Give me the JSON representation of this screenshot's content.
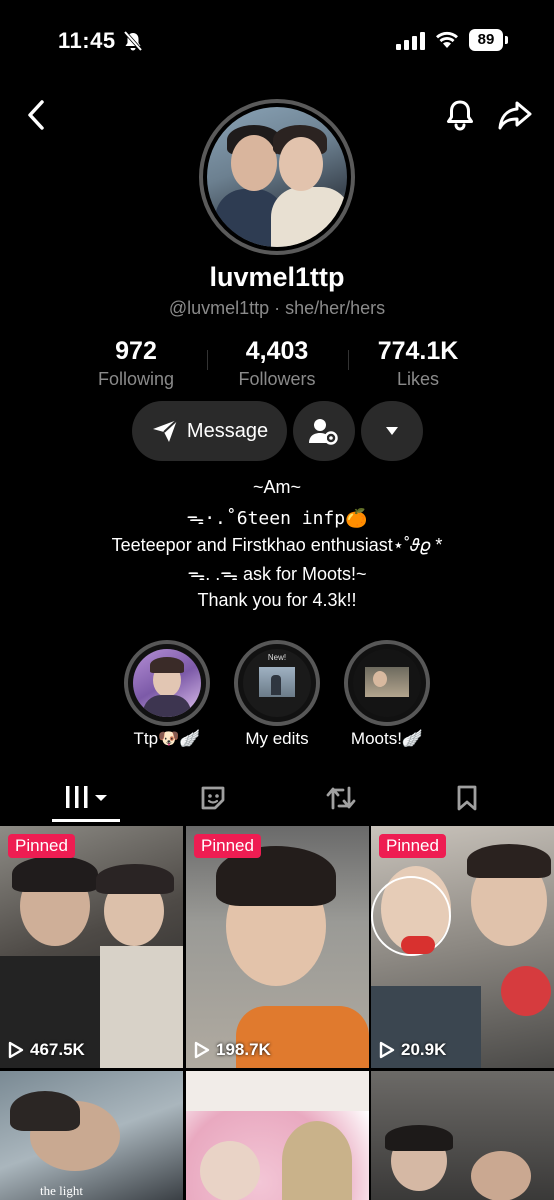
{
  "status_bar": {
    "time": "11:45",
    "battery": "89"
  },
  "profile": {
    "username": "luvmel1ttp",
    "handle_pronouns": "@luvmel1ttp · she/her/hers",
    "stats": [
      {
        "value": "972",
        "label": "Following"
      },
      {
        "value": "4,403",
        "label": "Followers"
      },
      {
        "value": "774.1K",
        "label": "Likes"
      }
    ],
    "message_label": "Message",
    "bio": [
      "~Am~",
      "ᯓ·.˚6teen    infp🍊",
      "Teeteepor and Firstkhao enthusiast⋆˚𝜗𝜚 *",
      "ᯓ. .ᯓ ask for Moots!~",
      "Thank you for 4.3k!!"
    ]
  },
  "highlights": [
    {
      "label": "Ttp🐶🪽"
    },
    {
      "label": "My edits",
      "overlay": "New!"
    },
    {
      "label": "Moots!🪽"
    }
  ],
  "videos": [
    {
      "pinned": "Pinned",
      "views": "467.5K"
    },
    {
      "pinned": "Pinned",
      "views": "198.7K"
    },
    {
      "pinned": "Pinned",
      "views": "20.9K"
    },
    {
      "caption": "the light"
    },
    {},
    {}
  ],
  "colors": {
    "background": "#000000",
    "pinned_badge": "#ee1d52",
    "button_bg": "#2a2a2a",
    "muted_text": "#8a8a8a"
  }
}
